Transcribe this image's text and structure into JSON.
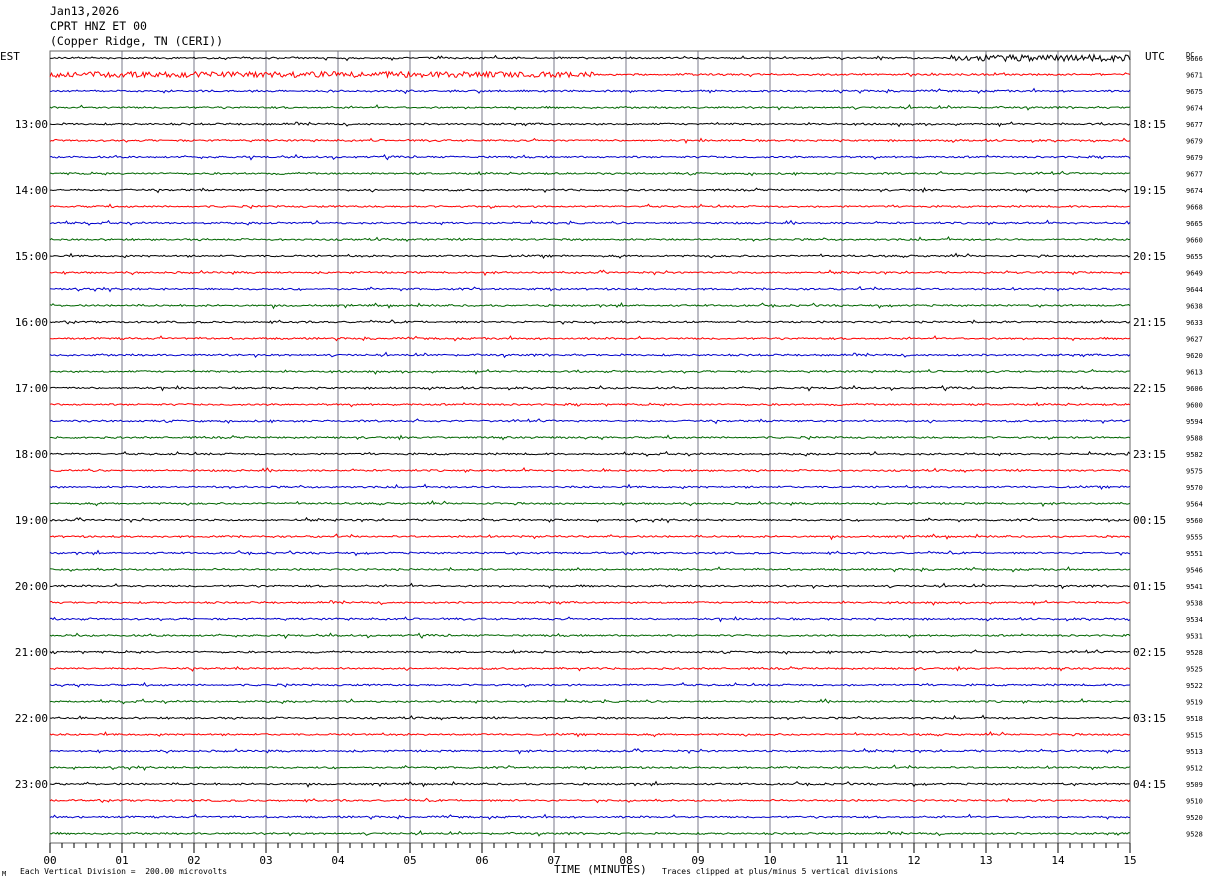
{
  "header": {
    "date": "Jan13,2026",
    "station": "CPRT HNZ ET 00",
    "location": "(Copper Ridge, TN (CERI))"
  },
  "chart_data": {
    "type": "line",
    "subtype": "helicorder",
    "xlabel": "TIME (MINUTES)",
    "xlim": [
      0,
      15
    ],
    "x_ticks": [
      "00",
      "01",
      "02",
      "03",
      "04",
      "05",
      "06",
      "07",
      "08",
      "09",
      "10",
      "11",
      "12",
      "13",
      "14",
      "15"
    ],
    "left_axis_label": "EST",
    "right_axis_label": "UTC",
    "dc_label": "DC",
    "left_time_labels": [
      "13:00",
      "14:00",
      "15:00",
      "16:00",
      "17:00",
      "18:00",
      "19:00",
      "20:00",
      "21:00",
      "22:00",
      "23:00"
    ],
    "right_time_labels": [
      "18:15",
      "19:15",
      "20:15",
      "21:15",
      "22:15",
      "23:15",
      "00:15",
      "01:15",
      "02:15",
      "03:15",
      "04:15"
    ],
    "dc_values": [
      "9666",
      "9671",
      "9675",
      "9674",
      "9677",
      "9679",
      "9679",
      "9677",
      "9674",
      "9668",
      "9665",
      "9660",
      "9655",
      "9649",
      "9644",
      "9638",
      "9633",
      "9627",
      "9620",
      "9613",
      "9606",
      "9600",
      "9594",
      "9588",
      "9582",
      "9575",
      "9570",
      "9564",
      "9560",
      "9555",
      "9551",
      "9546",
      "9541",
      "9538",
      "9534",
      "9531",
      "9528",
      "9525",
      "9522",
      "9519",
      "9518",
      "9515",
      "9513",
      "9512",
      "9509",
      "9510",
      "9520",
      "9528"
    ],
    "trace_colors": [
      "#000000",
      "#ff0000",
      "#0000cc",
      "#006600"
    ],
    "grid": true,
    "scale_note": "Each Vertical Division =  200.00 microvolts",
    "clip_note": "Traces clipped at plus/minus 5 vertical divisions",
    "corner_mark": "M"
  }
}
